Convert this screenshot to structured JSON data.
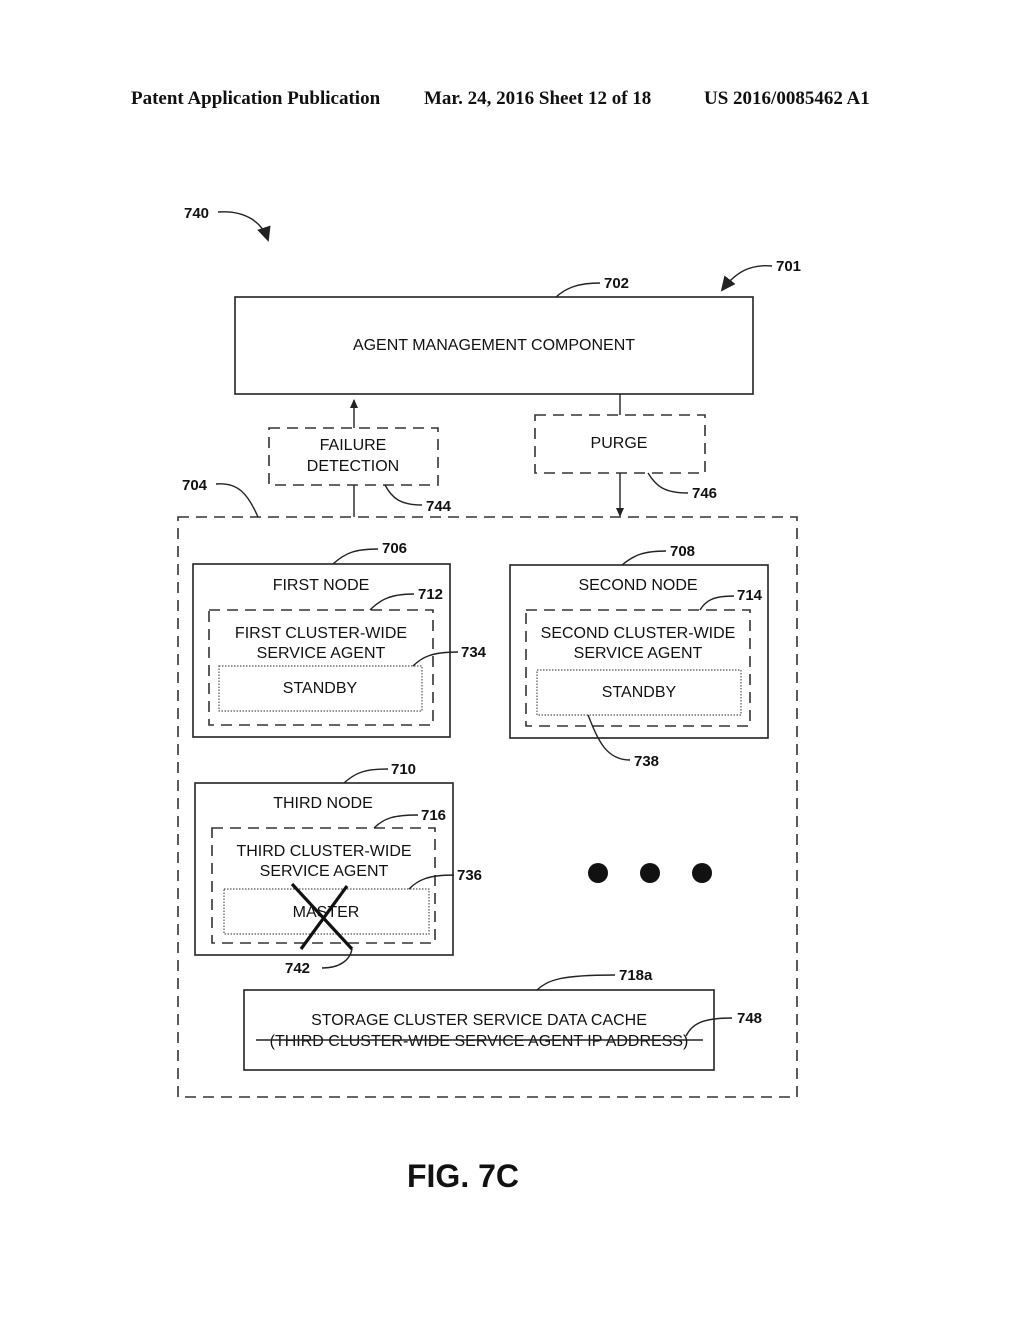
{
  "header": {
    "publication": "Patent Application Publication",
    "date_sheet": "Mar. 24, 2016  Sheet 12 of 18",
    "patent_number": "US 2016/0085462 A1"
  },
  "figure": {
    "caption": "FIG. 7C",
    "refs": {
      "figure": "740",
      "system": "701",
      "agent_mgmt": "702",
      "cluster": "704",
      "first_node": "706",
      "second_node": "708",
      "third_node": "710",
      "first_agent": "712",
      "second_agent": "714",
      "third_agent": "716",
      "cache": "718a",
      "first_role": "734",
      "third_role": "736",
      "second_role": "738",
      "failure_mark": "742",
      "failure_detection": "744",
      "purge": "746",
      "cache_entry": "748"
    },
    "agent_management": "AGENT MANAGEMENT COMPONENT",
    "failure_detection": [
      "FAILURE",
      "DETECTION"
    ],
    "purge": "PURGE",
    "nodes": [
      {
        "title": "FIRST NODE",
        "agent": [
          "FIRST CLUSTER-WIDE",
          "SERVICE AGENT"
        ],
        "role": "STANDBY"
      },
      {
        "title": "SECOND NODE",
        "agent": [
          "SECOND CLUSTER-WIDE",
          "SERVICE AGENT"
        ],
        "role": "STANDBY"
      },
      {
        "title": "THIRD NODE",
        "agent": [
          "THIRD CLUSTER-WIDE",
          "SERVICE AGENT"
        ],
        "role": "MASTER",
        "failed": true
      }
    ],
    "cache": {
      "title": "STORAGE CLUSTER SERVICE DATA CACHE",
      "entry": "(THIRD CLUSTER-WIDE SERVICE AGENT IP ADDRESS)",
      "entry_struck": true
    }
  }
}
